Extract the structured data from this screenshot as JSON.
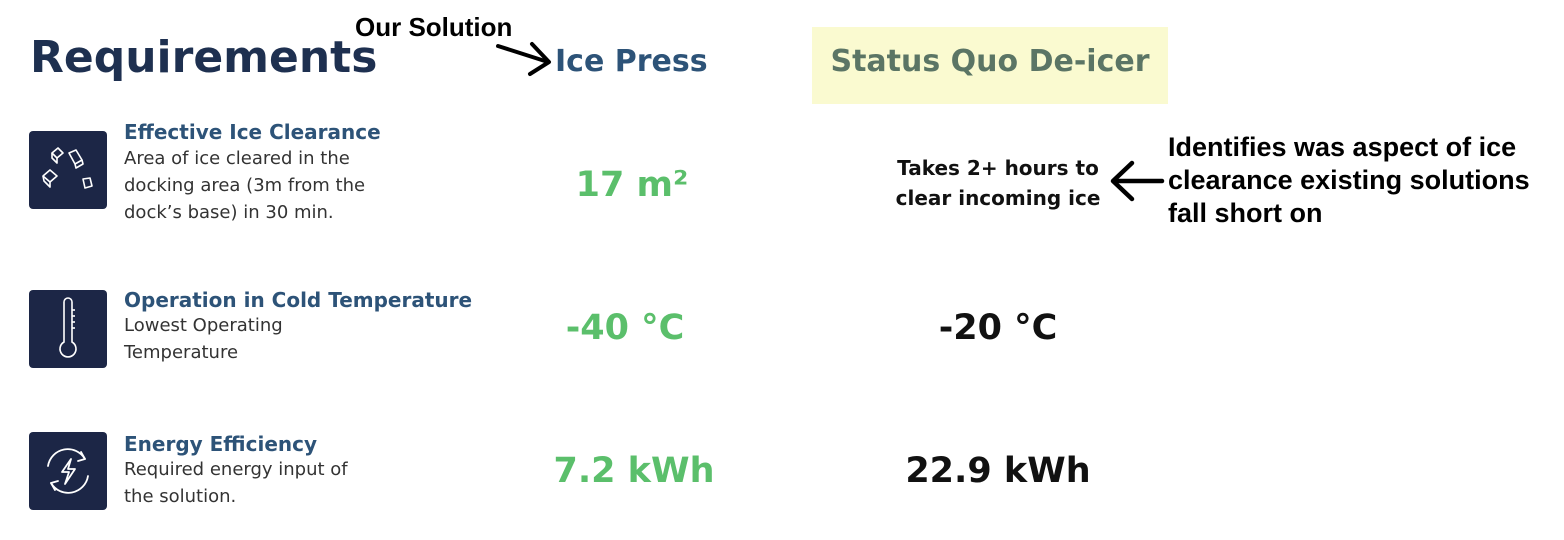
{
  "header": {
    "title": "Requirements",
    "annotation": "Our Solution",
    "col_ours": "Ice Press",
    "col_quo": "Status Quo De-icer"
  },
  "rows": [
    {
      "title": "Effective Ice Clearance",
      "desc": "Area of ice cleared in the\ndocking area (3m from the\ndock’s base) in 30 min.",
      "ours": "17 m²",
      "quo": "Takes 2+ hours to\nclear incoming ice",
      "icon": "ice-cubes-icon"
    },
    {
      "title": "Operation in Cold Temperature",
      "desc": "Lowest Operating\nTemperature",
      "ours": "-40 °C",
      "quo": "-20 °C",
      "icon": "thermometer-icon"
    },
    {
      "title": "Energy Efficiency",
      "desc": "Required energy input of\nthe solution.",
      "ours": "7.2 kWh",
      "quo": "22.9 kWh",
      "icon": "energy-cycle-icon"
    }
  ],
  "side_annotation": "Identifies was aspect of ice\nclearance existing solutions\nfall short on",
  "colors": {
    "heading": "#1e3050",
    "accent_blue": "#2d5378",
    "ours_green": "#5bbf6b",
    "quo_highlight": "#fafad0",
    "icon_bg": "#1c2646"
  }
}
